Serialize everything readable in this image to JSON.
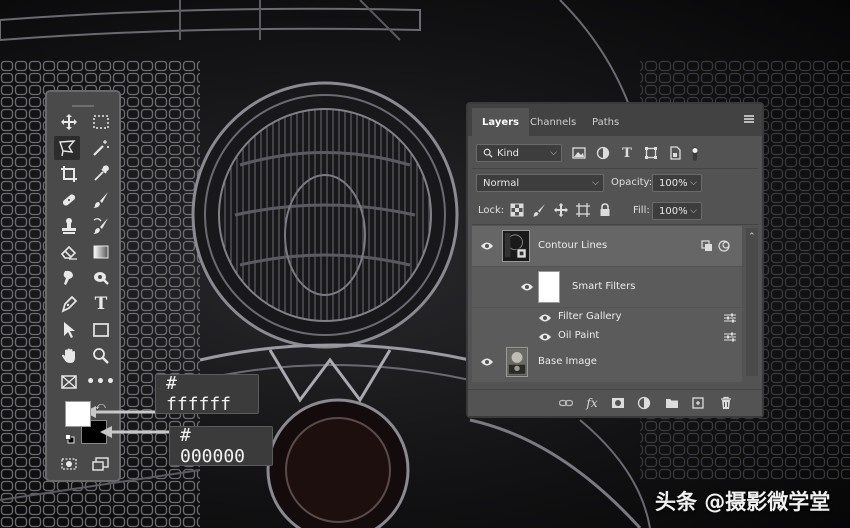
{
  "canvas": {
    "background": "#141416",
    "edge_color": "#8c8c94"
  },
  "toolbox": {
    "tools": [
      {
        "name": "move-tool",
        "icon": "move-icon"
      },
      {
        "name": "marquee-tool",
        "icon": "marquee-icon"
      },
      {
        "name": "polygonal-lasso-tool",
        "icon": "lasso-icon",
        "active": true
      },
      {
        "name": "magic-wand-tool",
        "icon": "magic-wand-icon"
      },
      {
        "name": "crop-tool",
        "icon": "crop-icon"
      },
      {
        "name": "eyedropper-tool",
        "icon": "eyedropper-icon"
      },
      {
        "name": "healing-brush-tool",
        "icon": "bandage-icon"
      },
      {
        "name": "brush-tool",
        "icon": "brush-icon"
      },
      {
        "name": "clone-stamp-tool",
        "icon": "stamp-icon"
      },
      {
        "name": "history-brush-tool",
        "icon": "history-brush-icon"
      },
      {
        "name": "eraser-tool",
        "icon": "eraser-icon"
      },
      {
        "name": "gradient-tool",
        "icon": "gradient-icon"
      },
      {
        "name": "smudge-tool",
        "icon": "smudge-icon"
      },
      {
        "name": "dodge-tool",
        "icon": "dodge-icon"
      },
      {
        "name": "pen-tool",
        "icon": "pen-icon"
      },
      {
        "name": "type-tool",
        "icon": "type-icon",
        "glyph": "T"
      },
      {
        "name": "path-selection-tool",
        "icon": "arrow-icon"
      },
      {
        "name": "rectangle-tool",
        "icon": "rectangle-icon"
      },
      {
        "name": "hand-tool",
        "icon": "hand-icon"
      },
      {
        "name": "zoom-tool",
        "icon": "zoom-icon"
      },
      {
        "name": "frame-tool",
        "icon": "frame-icon"
      },
      {
        "name": "more-tools",
        "icon": "more-icon",
        "glyph": "•••"
      }
    ],
    "foreground_color": "#ffffff",
    "background_color": "#000000"
  },
  "callouts": {
    "foreground": "# ffffff",
    "background": "# 000000"
  },
  "layers_panel": {
    "tabs": [
      "Layers",
      "Channels",
      "Paths"
    ],
    "active_tab": "Layers",
    "filter_kind": "Kind",
    "blend_mode": "Normal",
    "opacity_label": "Opacity:",
    "opacity_value": "100%",
    "lock_label": "Lock:",
    "fill_label": "Fill:",
    "fill_value": "100%",
    "layers": [
      {
        "name": "Contour Lines",
        "type": "smart-object",
        "selected": true
      },
      {
        "name": "Smart Filters",
        "type": "smart-filters-mask"
      },
      {
        "name": "Filter Gallery",
        "type": "filter"
      },
      {
        "name": "Oil Paint",
        "type": "filter"
      },
      {
        "name": "Base Image",
        "type": "pixel"
      }
    ],
    "bottom_icons": [
      "link-icon",
      "fx-icon",
      "mask-icon",
      "adjustment-icon",
      "folder-icon",
      "new-layer-icon",
      "trash-icon"
    ]
  },
  "watermark": "头条 @摄影微学堂"
}
